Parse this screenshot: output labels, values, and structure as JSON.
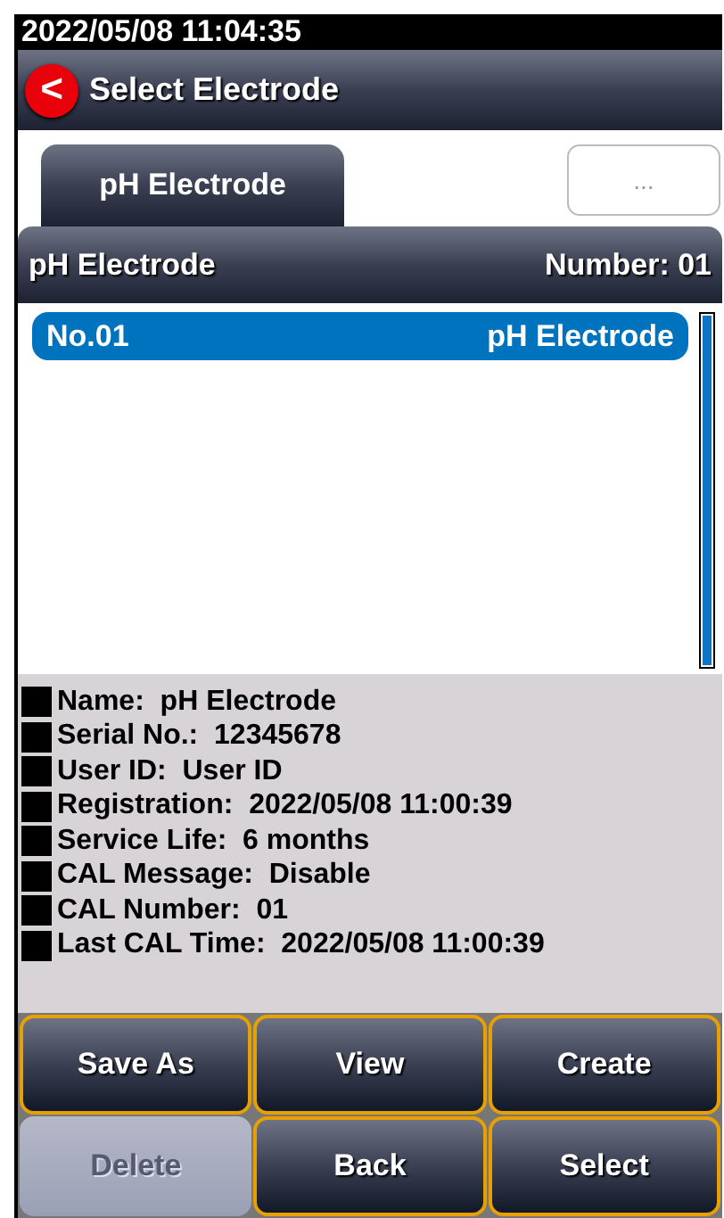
{
  "status_bar": {
    "datetime": "2022/05/08  11:04:35"
  },
  "title_bar": {
    "back_icon": "<",
    "title": "Select Electrode"
  },
  "tabs": [
    {
      "label": "pH Electrode",
      "selected": true
    }
  ],
  "more_button": "...",
  "panel": {
    "title": "pH Electrode",
    "number": "Number:  01"
  },
  "list": [
    {
      "number": "No.01",
      "name": "pH  Electrode",
      "selected": true
    }
  ],
  "details": [
    {
      "label": "Name:",
      "value": "pH  Electrode"
    },
    {
      "label": "Serial No.:",
      "value": "12345678"
    },
    {
      "label": "User ID:",
      "value": "User ID"
    },
    {
      "label": "Registration:",
      "value": "2022/05/08  11:00:39"
    },
    {
      "label": "Service Life:",
      "value": "6  months"
    },
    {
      "label": "CAL Message:",
      "value": "Disable"
    },
    {
      "label": "CAL Number:",
      "value": "01"
    },
    {
      "label": "Last CAL Time:",
      "value": "2022/05/08  11:00:39"
    }
  ],
  "buttons": [
    {
      "label": "Save  As",
      "disabled": false
    },
    {
      "label": "View",
      "disabled": false
    },
    {
      "label": "Create",
      "disabled": false
    },
    {
      "label": "Delete",
      "disabled": true
    },
    {
      "label": "Back",
      "disabled": false
    },
    {
      "label": "Select",
      "disabled": false
    }
  ]
}
